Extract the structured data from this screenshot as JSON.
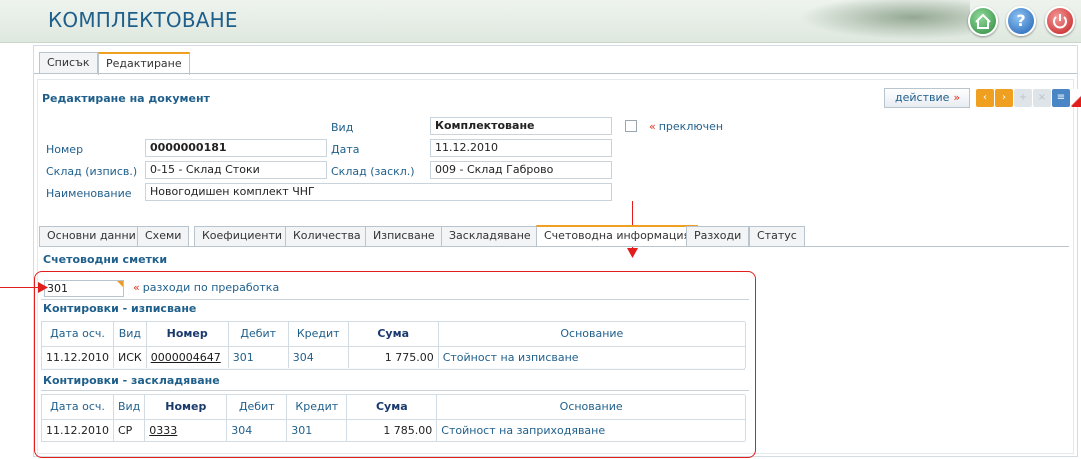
{
  "header": {
    "title": "КОМПЛЕКТОВАНЕ",
    "buttons": [
      {
        "name": "home",
        "icon": "home-icon",
        "color": "#2e8a3f"
      },
      {
        "name": "help",
        "icon": "help-icon",
        "glyph": "?",
        "color": "#1d5fb3"
      },
      {
        "name": "power",
        "icon": "power-icon",
        "color": "#c21d1d"
      }
    ]
  },
  "top_tabs": [
    {
      "label": "Списък",
      "active": false
    },
    {
      "label": "Редактиране",
      "active": true
    }
  ],
  "doc": {
    "heading": "Редактиране на документ",
    "action_label": "действие",
    "action_arrow": "»",
    "toolbar_icons": [
      "prev-icon",
      "next-icon",
      "add-icon",
      "delete-icon",
      "print-icon",
      "clear-icon",
      "confirm-icon"
    ],
    "fields": {
      "type_label": "Вид",
      "type_value": "Комплектоване",
      "number_label": "Номер",
      "number_value": "0000000181",
      "date_label": "Дата",
      "date_value": "11.12.2010",
      "wh_out_label": "Склад (изписв.)",
      "wh_out_value": "0-15 - Склад Стоки",
      "wh_in_label": "Склад (заскл.)",
      "wh_in_value": "009 - Склад Габрово",
      "name_label": "Наименование",
      "name_value": "Новогодишен комплект ЧНГ"
    },
    "switched_prefix": "«",
    "switched_label": "преключен",
    "switched_checked": false
  },
  "sub_tabs": [
    {
      "label": "Основни данни",
      "active": false
    },
    {
      "label": "Схеми",
      "active": false
    },
    {
      "label": "Коефициенти",
      "active": false
    },
    {
      "label": "Количества",
      "active": false
    },
    {
      "label": "Изписване",
      "active": false
    },
    {
      "label": "Заскладяване",
      "active": false
    },
    {
      "label": "Счетоводна информация",
      "active": true
    },
    {
      "label": "Разходи",
      "active": false
    },
    {
      "label": "Статус",
      "active": false
    }
  ],
  "accounting": {
    "title": "Счетоводни сметки",
    "account_code": "301",
    "account_prefix": "«",
    "account_note": "разходи по преработка",
    "outflow_title": "Контировки - изписване",
    "inflow_title": "Контировки - заскладяване",
    "columns": [
      "Дата осч.",
      "Вид",
      "Номер",
      "Дебит",
      "Кредит",
      "Сума",
      "Основание"
    ],
    "outflow_rows": [
      {
        "date": "11.12.2010",
        "kind": "ИСК",
        "number": "0000004647",
        "debit": "301",
        "credit": "304",
        "amount": "1 775.00",
        "reason": "Стойност на изписване"
      }
    ],
    "inflow_rows": [
      {
        "date": "11.12.2010",
        "kind": "СР",
        "number": "0333",
        "debit": "304",
        "credit": "301",
        "amount": "1 785.00",
        "reason": "Стойност на заприходяване"
      }
    ]
  },
  "colors": {
    "accent": "#1f5f8b",
    "highlight": "#e31c1c",
    "tab_active_border": "#f0a020"
  }
}
